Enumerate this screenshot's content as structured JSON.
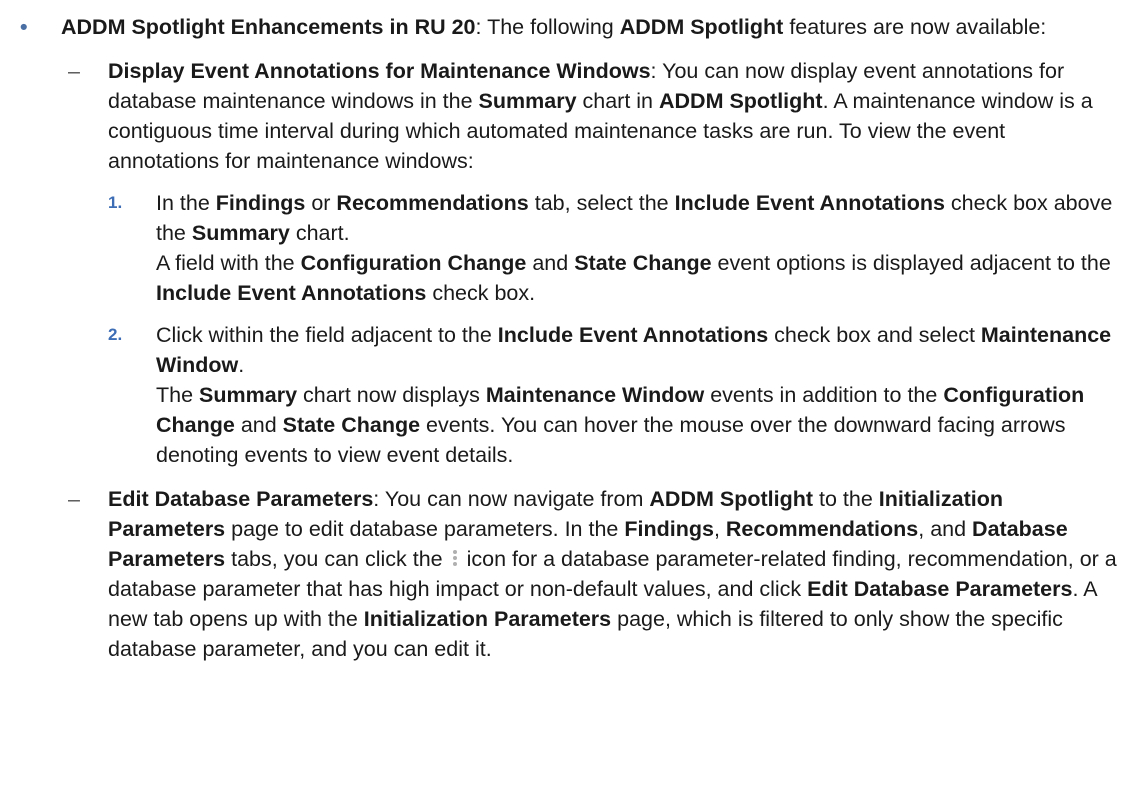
{
  "item": {
    "title": "ADDM Spotlight Enhancements in RU 20",
    "t1": ": The following ",
    "b1": "ADDM Spotlight",
    "t2": " features are now available:"
  },
  "sub1": {
    "title": "Display Event Annotations for Maintenance Windows",
    "t1": ": You can now display event annotations for database maintenance windows in the ",
    "b1": "Summary",
    "t2": " chart in ",
    "b2": "ADDM Spotlight",
    "t3": ". A maintenance window is a contiguous time interval during which automated maintenance tasks are run. To view the event annotations for maintenance windows:"
  },
  "steps": [
    {
      "num": "1.",
      "t1": "In the ",
      "b1": "Findings",
      "t2": " or ",
      "b2": "Recommendations",
      "t3": " tab, select the ",
      "b3": "Include Event Annotations",
      "t4": " check box above the ",
      "b4": "Summary",
      "t5": " chart.",
      "r1": "A field with the ",
      "rb1": "Configuration Change",
      "r2": " and ",
      "rb2": "State Change",
      "r3": " event options is displayed adjacent to the ",
      "rb3": "Include Event Annotations",
      "r4": " check box."
    },
    {
      "num": "2.",
      "t1": "Click within the field adjacent to the ",
      "b1": "Include Event Annotations",
      "t2": " check box and select ",
      "b2": "Maintenance Window",
      "t3": ".",
      "r1": "The ",
      "rb1": "Summary",
      "r2": " chart now displays ",
      "rb2": "Maintenance Window",
      "r3": " events in addition to the ",
      "rb3": "Configuration Change",
      "r4": " and ",
      "rb4": "State Change",
      "r5": " events. You can hover the mouse over the downward facing arrows denoting events to view event details."
    }
  ],
  "sub2": {
    "title": "Edit Database Parameters",
    "t1": ": You can now navigate from ",
    "b1": "ADDM Spotlight",
    "t2": " to the ",
    "b2": "Initialization Parameters",
    "t3": " page to edit database parameters. In the ",
    "b3": "Findings",
    "t4": ", ",
    "b4": "Recommendations",
    "t5": ", and ",
    "b5": "Database Parameters",
    "t6": " tabs, you can click the ",
    "icon": "kebab-vertical-icon",
    "t7": " icon for a database parameter-related finding, recommendation, or a database parameter that has high impact or non-default values, and click ",
    "b6": "Edit Database Parameters",
    "t8": ". A new tab opens up with the ",
    "b7": "Initialization Parameters",
    "t9": " page, which is filtered to only show the specific database parameter, and you can edit it."
  },
  "colors": {
    "bullet": "#4a6fa5",
    "step_number": "#3d6db5",
    "kebab": "#b0b0b0"
  }
}
